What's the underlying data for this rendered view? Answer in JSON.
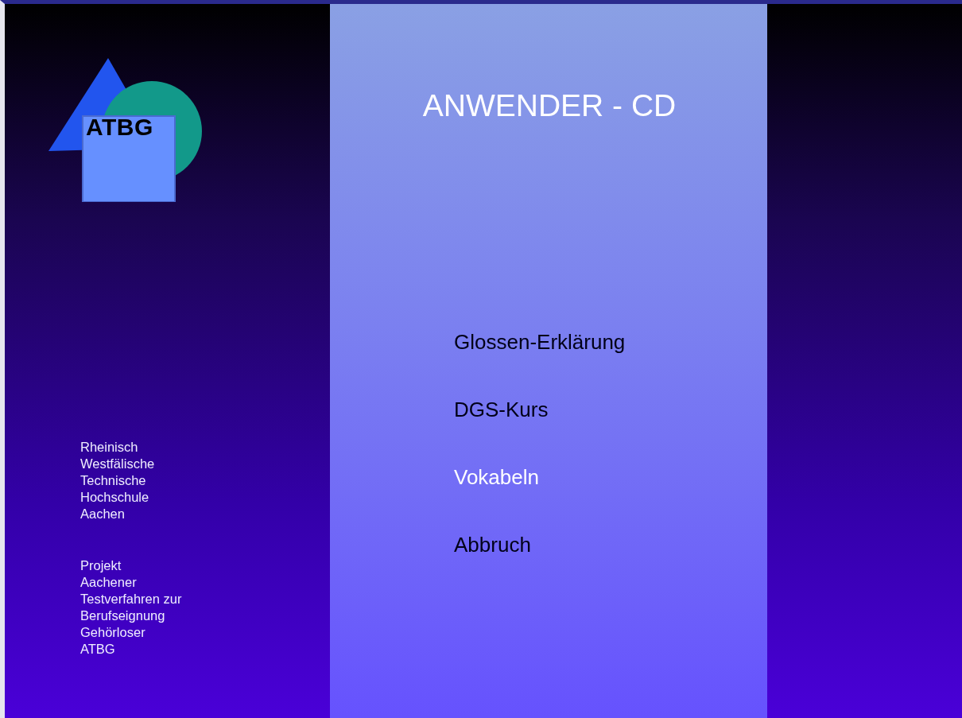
{
  "logo": {
    "text": "ATBG"
  },
  "info_blocks": [
    {
      "lines": [
        "Rheinisch",
        "Westfälische",
        "Technische",
        "Hochschule",
        "Aachen"
      ]
    },
    {
      "lines": [
        "Projekt",
        "Aachener",
        "Testverfahren zur",
        "Berufseignung",
        "Gehörloser",
        "ATBG"
      ]
    }
  ],
  "title": "ANWENDER - CD",
  "menu": [
    {
      "label": "Glossen-Erklärung",
      "selected": false
    },
    {
      "label": "DGS-Kurs",
      "selected": false
    },
    {
      "label": "Vokabeln",
      "selected": true
    },
    {
      "label": "Abbruch",
      "selected": false
    }
  ]
}
